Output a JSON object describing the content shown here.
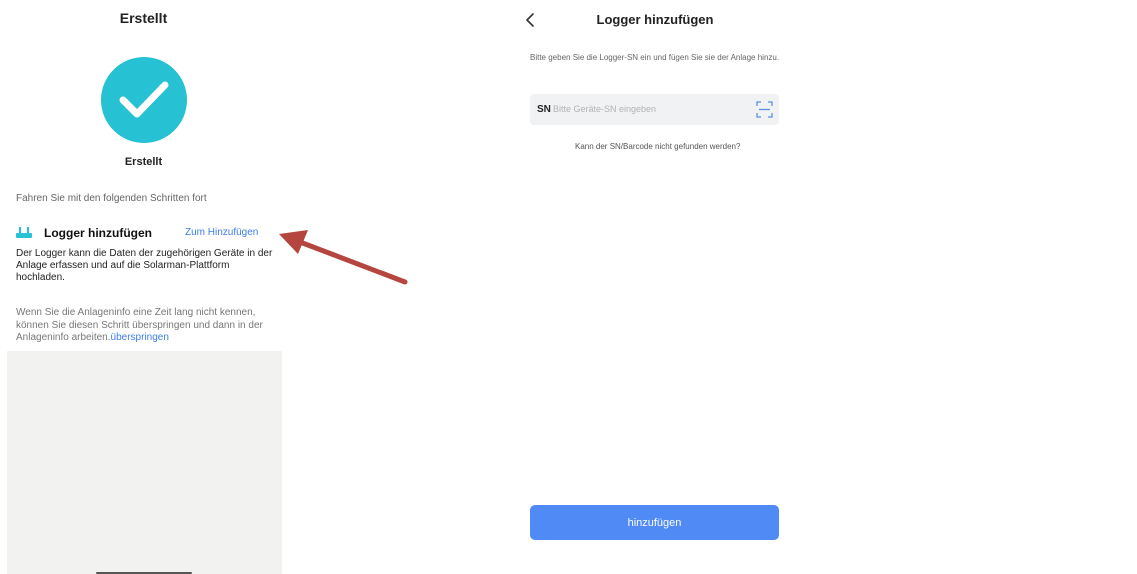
{
  "left_screen": {
    "header_title": "Erstellt",
    "status_label": "Erstellt",
    "steps_intro": "Fahren Sie mit den folgenden Schritten fort",
    "logger_step": {
      "title": "Logger hinzufügen",
      "action_link": "Zum Hinzufügen",
      "description": "Der Logger kann die Daten der zugehörigen Geräte in der Anlage erfassen und auf die Solarman-Plattform hochladen."
    },
    "skip_note": {
      "text": "Wenn Sie die Anlageninfo eine Zeit lang nicht kennen, können Sie diesen Schritt überspringen und dann in der Anlageninfo arbeiten.",
      "link": "überspringen"
    }
  },
  "right_screen": {
    "header_title": "Logger hinzufügen",
    "instruction": "Bitte geben Sie die Logger-SN ein und fügen Sie sie der Anlage hinzu.",
    "sn_field": {
      "prefix": "SN",
      "value": "",
      "placeholder": "Bitte Geräte-SN eingeben"
    },
    "help_link": "Kann der SN/Barcode nicht gefunden werden?",
    "submit_label": "hinzufügen"
  },
  "icons": {
    "check": "check-icon",
    "logger": "router-icon",
    "back": "chevron-left-icon",
    "scan": "scan-icon"
  },
  "colors": {
    "success": "#26c1d3",
    "link": "#3d7ee8",
    "primary_button": "#4f8af5",
    "annotation_arrow": "#b5453f"
  }
}
